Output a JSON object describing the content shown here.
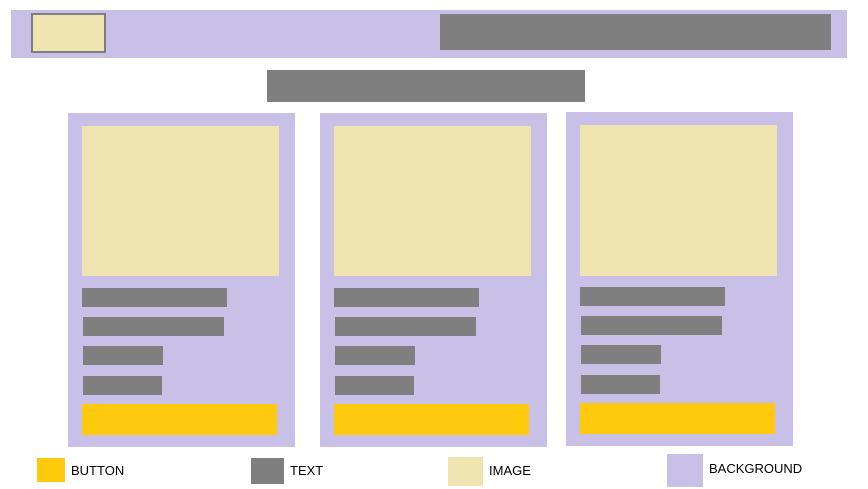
{
  "colors": {
    "background": "#c8c0e6",
    "text": "#7f7f7f",
    "image": "#efe4b0",
    "button": "#ffc90e"
  },
  "cards": [
    {
      "lines": 4,
      "button": true
    },
    {
      "lines": 4,
      "button": true
    },
    {
      "lines": 4,
      "button": true
    }
  ],
  "legend": {
    "button": "BUTTON",
    "text": "TEXT",
    "image": "IMAGE",
    "background": "BACKGROUND"
  }
}
